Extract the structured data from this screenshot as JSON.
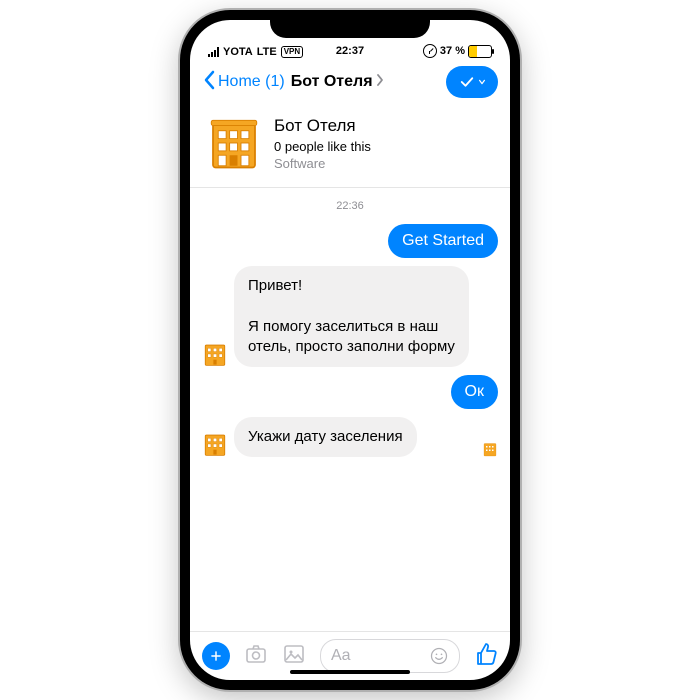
{
  "status": {
    "carrier": "YOTA",
    "network": "LTE",
    "vpn": "VPN",
    "time": "22:37",
    "battery_pct": "37 %"
  },
  "nav": {
    "back_label": "Home (1)",
    "title": "Бот Отеля"
  },
  "profile": {
    "name": "Бот Отеля",
    "likes": "0 people like this",
    "category": "Software"
  },
  "conversation": {
    "timestamp": "22:36",
    "msg_get_started": "Get Started",
    "msg_intro": "Привет!\n\nЯ помогу заселиться в наш отель, просто заполни форму",
    "msg_ok": "Ок",
    "msg_date": "Укажи дату заселения"
  },
  "composer": {
    "placeholder": "Aa"
  }
}
